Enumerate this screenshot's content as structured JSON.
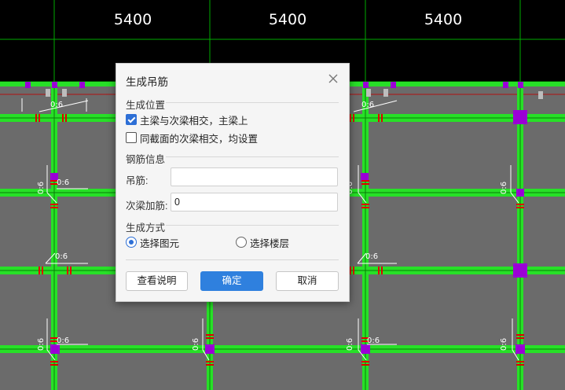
{
  "drawing": {
    "dimension_labels": [
      "5400",
      "5400",
      "5400"
    ],
    "beam_label": "0:6",
    "colors": {
      "background_top": "#000000",
      "background_plan": "#6b6b6b",
      "beam": "#27e027",
      "axis": "#00aa00",
      "column": "#9b00d6",
      "hanger_bar": "#e00000",
      "annotation": "#ffffff"
    }
  },
  "dialog": {
    "title": "生成吊筋",
    "close_icon": "close-icon",
    "section_position": "生成位置",
    "check_main_secondary": {
      "label": "主梁与次梁相交，主梁上",
      "checked": true
    },
    "check_same_section": {
      "label": "同截面的次梁相交，均设置",
      "checked": false
    },
    "section_rebar": "钢筋信息",
    "hanger_label": "吊筋:",
    "hanger_value": "",
    "secondary_add_label": "次梁加筋:",
    "secondary_add_value": "0",
    "section_method": "生成方式",
    "radio_select_element": {
      "label": "选择图元",
      "selected": true
    },
    "radio_select_floor": {
      "label": "选择楼层",
      "selected": false
    },
    "buttons": {
      "help": "查看说明",
      "ok": "确定",
      "cancel": "取消"
    }
  }
}
